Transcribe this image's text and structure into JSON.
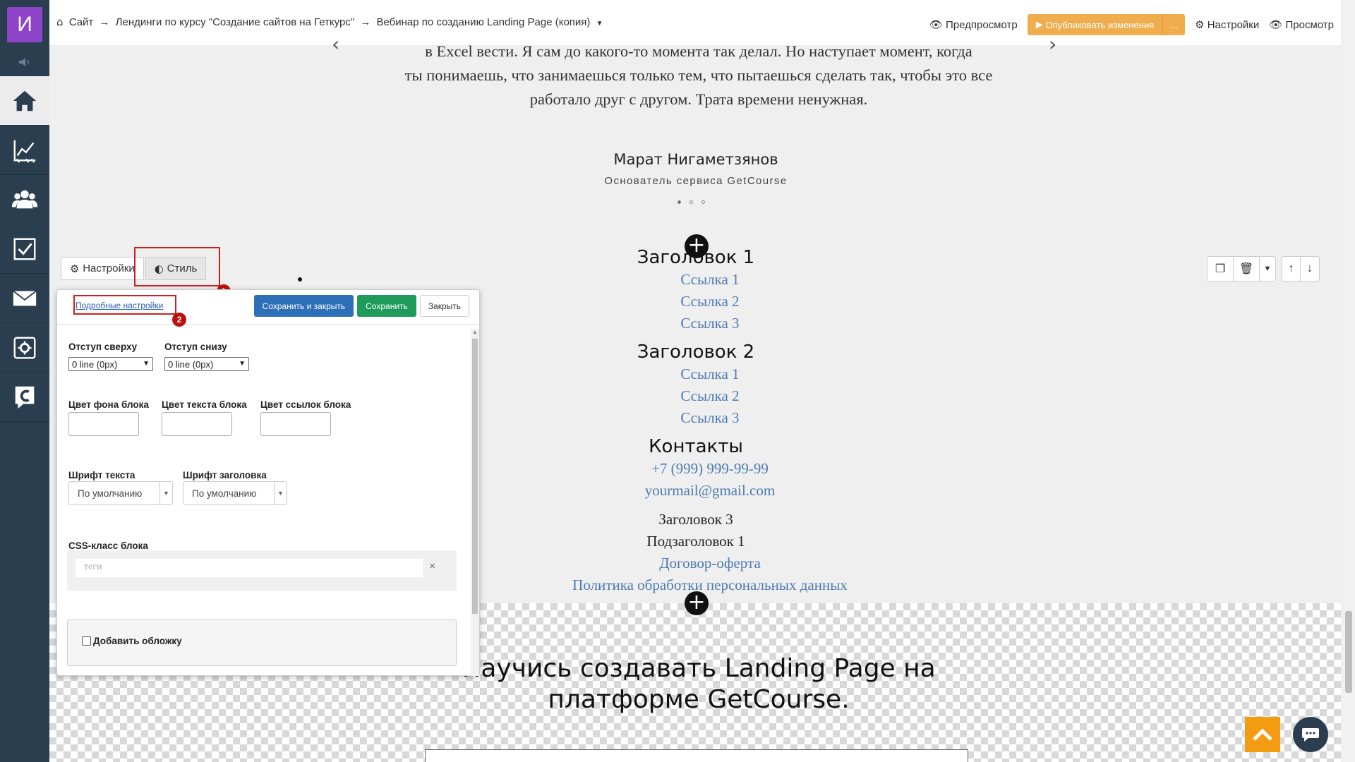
{
  "app": {
    "logo_letter": "И",
    "brand_color": "#8e44c9",
    "sidebar_color": "#2b3e50",
    "accent_orange": "#f0ad4e"
  },
  "sidebar": {
    "items": [
      {
        "name": "home",
        "icon": "home-icon"
      },
      {
        "name": "analytics",
        "icon": "chart-icon"
      },
      {
        "name": "users",
        "icon": "users-icon"
      },
      {
        "name": "tasks",
        "icon": "checkbox-icon"
      },
      {
        "name": "mail",
        "icon": "mail-icon"
      },
      {
        "name": "settings",
        "icon": "gear-icon"
      },
      {
        "name": "getcourse",
        "icon": "getcourse-icon"
      }
    ]
  },
  "topbar": {
    "breadcrumb": {
      "site": "Сайт",
      "arrow": "→",
      "section": "Лендинги по курсу \"Создание сайтов на Геткурс\"",
      "page": "Вебинар по созданию Landing Page (копия)"
    },
    "preview_label": "Предпросмотр",
    "publish_label": "Опубликовать изменения",
    "publish_more": "...",
    "settings_label": "Настройки",
    "view_label": "Просмотр"
  },
  "content": {
    "quote_line1": "в Excel вести. Я сам до какого-то момента так делал. Но наступает момент, когда",
    "quote_line2": "ты понимаешь, что занимаешься только тем, что пытаешься сделать так, чтобы это все",
    "quote_line3": "работало друг с другом. Трата времени ненужная.",
    "author_name": "Марат Нигаметзянов",
    "author_role": "Основатель сервиса GetCourse",
    "slider_dots": 3,
    "slider_active": 1,
    "footer": {
      "heading1": "Заголовок 1",
      "links1": [
        "Ссылка 1",
        "Ссылка 2",
        "Ссылка 3"
      ],
      "heading2": "Заголовок 2",
      "links2": [
        "Ссылка 1",
        "Ссылка 2",
        "Ссылка 3"
      ],
      "contacts_heading": "Контакты",
      "phone": "+7 (999) 999-99-99",
      "email": "yourmail@gmail.com",
      "heading3": "Заголовок 3",
      "subheading1": "Подзаголовок 1",
      "offer": "Договор-оферта",
      "privacy": "Политика обработки персональных данных"
    },
    "next_block_title_line1": "Научись создавать Landing Page на",
    "next_block_title_line2": "платформе GetCourse."
  },
  "editor": {
    "tab_settings": "Настройки",
    "tab_style": "Стиль",
    "advanced_link": "Подробные настройки",
    "btn_save_close": "Сохранить и закрыть",
    "btn_save": "Сохранить",
    "btn_close": "Закрыть",
    "badge1": "1",
    "badge2": "2",
    "padding_top_label": "Отступ сверху",
    "padding_top_value": "0 line (0px)",
    "padding_bottom_label": "Отступ снизу",
    "padding_bottom_value": "0 line (0px)",
    "bg_color_label": "Цвет фона блока",
    "text_color_label": "Цвет текста блока",
    "link_color_label": "Цвет ссылок блока",
    "text_font_label": "Шрифт текста",
    "text_font_value": "По умолчанию",
    "heading_font_label": "Шрифт заголовка",
    "heading_font_value": "По умолчанию",
    "css_class_label": "CSS-класс блока",
    "tags_placeholder": "теги",
    "tags_clear": "×",
    "cover_label": "Добавить обложку"
  }
}
